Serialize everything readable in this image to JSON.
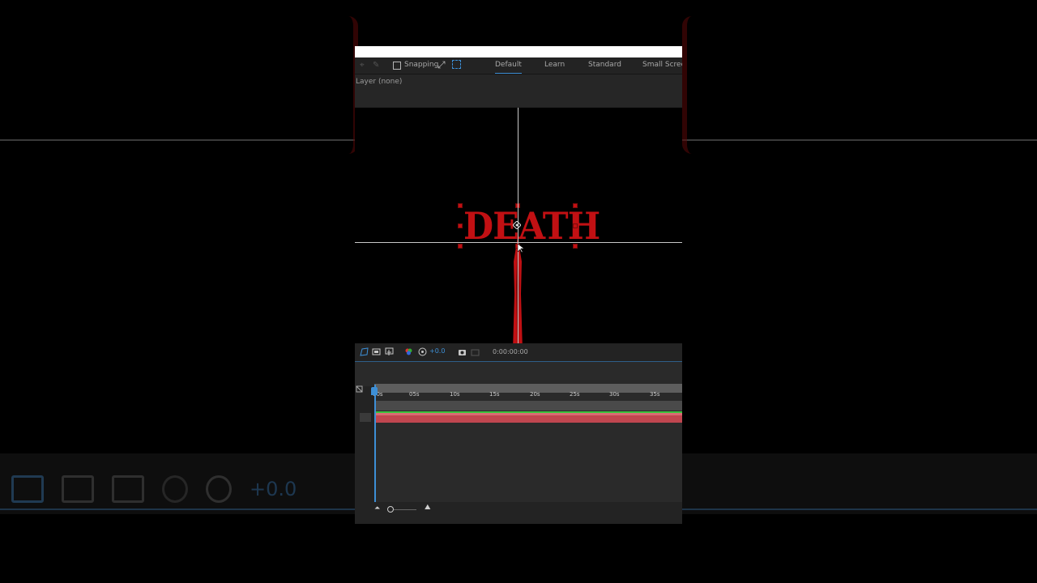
{
  "toolbar": {
    "snapping_label": "Snapping",
    "snapping_checked": false,
    "workspaces": [
      "Default",
      "Learn",
      "Standard",
      "Small Screen"
    ],
    "active_workspace": "Default"
  },
  "layer_panel": {
    "label": "Layer  (none)"
  },
  "viewer": {
    "text": "DEATH",
    "text_color": "#c11013"
  },
  "timeline_toolbar": {
    "exposure": "+0.0",
    "timecode": "0:00:00:00"
  },
  "timeline": {
    "ticks": [
      "00s",
      "05s",
      "10s",
      "15s",
      "20s",
      "25s",
      "30s",
      "35s"
    ],
    "layer_bar_color": "#c0464f",
    "playhead_color": "#3d8fd6"
  },
  "colors": {
    "accent": "#3d8fd6",
    "work_area_line": "#39c43e"
  }
}
